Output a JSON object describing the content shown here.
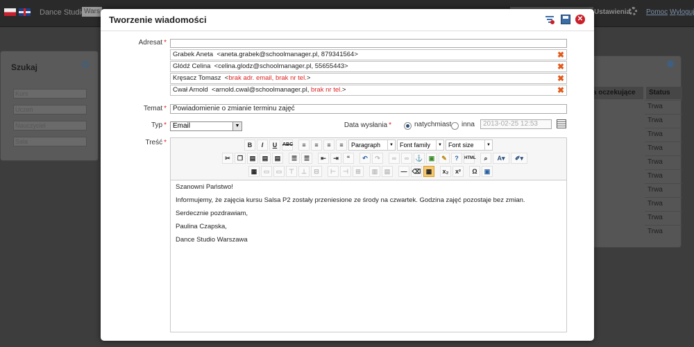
{
  "background": {
    "app_title": "Dance Studio",
    "school_select": "Wars",
    "nav": {
      "settings": "Ustawienia",
      "help": "Pomoc",
      "logout": "Wyloguj"
    },
    "search_panel": {
      "title": "Szukaj",
      "fields": [
        "Kurs",
        "Uczeń",
        "Nauczyciel",
        "Sala"
      ]
    },
    "table": {
      "headers": [
        "nia oczekujące",
        "Status"
      ],
      "rows": [
        "Trwa",
        "Trwa",
        "Trwa",
        "Trwa",
        "Trwa",
        "Trwa",
        "Trwa",
        "Trwa",
        "Trwa",
        "Trwa"
      ]
    }
  },
  "modal": {
    "title": "Tworzenie wiadomości",
    "labels": {
      "recipient": "Adresat",
      "subject": "Temat",
      "type": "Typ",
      "send_date": "Data wysłania",
      "body": "Treść",
      "required_mark": "*"
    },
    "recipients": [
      {
        "name": "Grabek Aneta",
        "contact": "<aneta.grabek@schoolmanager.pl, 879341564>",
        "error": ""
      },
      {
        "name": "Glódź Celina",
        "contact": "<celina.glodz@schoolmanager.pl, 55655443>",
        "error": ""
      },
      {
        "name": "Kręsacz Tomasz",
        "contact": "<",
        "error": "brak adr. email, brak nr tel.",
        "contact_end": ">"
      },
      {
        "name": "Cwał Arnold",
        "contact": "<arnold.cwal@schoolmanager.pl,",
        "error": "brak nr tel.",
        "contact_end": ">"
      }
    ],
    "subject_value": "Powiadomienie o zmianie terminu zajęć",
    "type_value": "Email",
    "send_options": {
      "now": "natychmiast",
      "other": "inna",
      "selected": "now"
    },
    "date_value": "2013-02-25 12:53",
    "editor": {
      "format_select": "Paragraph",
      "font_family_select": "Font family",
      "font_size_select": "Font size",
      "body_lines": [
        "Szanowni Państwo!",
        "Informujemy, że zajęcia kursu Salsa P2 zostały przeniesione ze środy na czwartek. Godzina zajęć pozostaje bez zmian.",
        "Serdecznie pozdrawiam,",
        "Paulina Czapska,",
        "Dance Studio Warszawa"
      ]
    }
  }
}
